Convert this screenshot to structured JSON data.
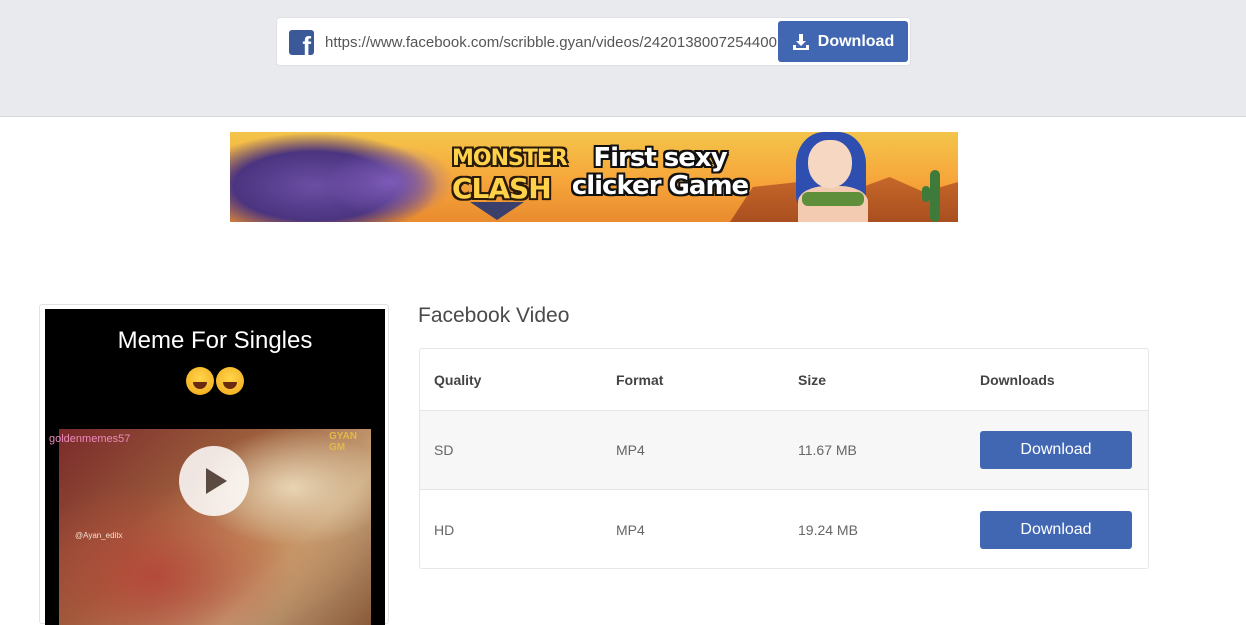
{
  "search": {
    "url_value": "https://www.facebook.com/scribble.gyan/videos/2420138007254400",
    "download_label": "Download",
    "icon": "download-icon",
    "brand_color": "#4267b2"
  },
  "banner_ad": {
    "logo_line1": "MONSTER",
    "logo_line2": "CLASH",
    "tagline_line1": "First sexy",
    "tagline_line2": "clicker Game"
  },
  "video": {
    "overlay_title": "Meme For Singles",
    "instagram_tag": "goldenmemes57",
    "watermark_line1": "GYAN",
    "watermark_line2": "GM",
    "editor_credit": "@Ayan_editx",
    "play_icon": "play-icon"
  },
  "results": {
    "title": "Facebook Video",
    "columns": [
      "Quality",
      "Format",
      "Size",
      "Downloads"
    ],
    "rows": [
      {
        "quality": "SD",
        "format": "MP4",
        "size": "11.67 MB",
        "action": "Download"
      },
      {
        "quality": "HD",
        "format": "MP4",
        "size": "19.24 MB",
        "action": "Download"
      }
    ]
  }
}
